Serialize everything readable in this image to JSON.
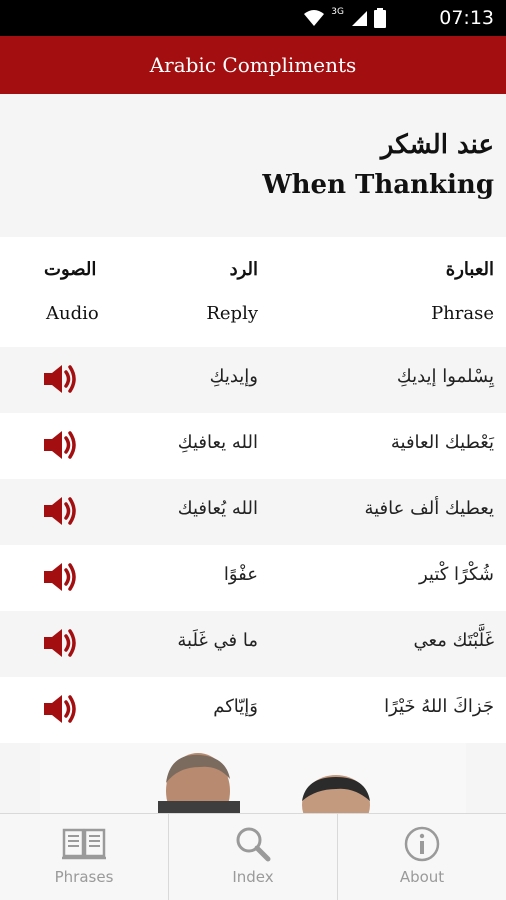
{
  "status_bar": {
    "network": "3G",
    "time": "07:13"
  },
  "app_bar": {
    "title": "Arabic Compliments"
  },
  "header": {
    "title_ar": "عند الشكر",
    "title_en": "When Thanking"
  },
  "columns": {
    "audio": {
      "ar": "الصوت",
      "en": "Audio"
    },
    "reply": {
      "ar": "الرد",
      "en": "Reply"
    },
    "phrase": {
      "ar": "العبارة",
      "en": "Phrase"
    }
  },
  "rows": [
    {
      "phrase": "يِسْلموا إيديكِ",
      "reply": "وإيديكِ"
    },
    {
      "phrase": "يَعْطيك العافية",
      "reply": "الله يعافيكِ"
    },
    {
      "phrase": "يعطيك ألف عافية",
      "reply": "الله يُعافيك"
    },
    {
      "phrase": "شُكْرًا كْتير",
      "reply": "عفْوًا"
    },
    {
      "phrase": "غَلَّبْتَك معي",
      "reply": "ما في غَلَبة"
    },
    {
      "phrase": "جَزاكَ اللهُ خَيْرًا",
      "reply": "وَإيّاكم"
    }
  ],
  "tabs": [
    {
      "label": "Phrases",
      "icon": "book-icon"
    },
    {
      "label": "Index",
      "icon": "magnifier-icon"
    },
    {
      "label": "About",
      "icon": "info-icon"
    }
  ],
  "colors": {
    "accent": "#a30f10",
    "status_bar": "#000000",
    "tab_label": "#9a9a9a"
  }
}
